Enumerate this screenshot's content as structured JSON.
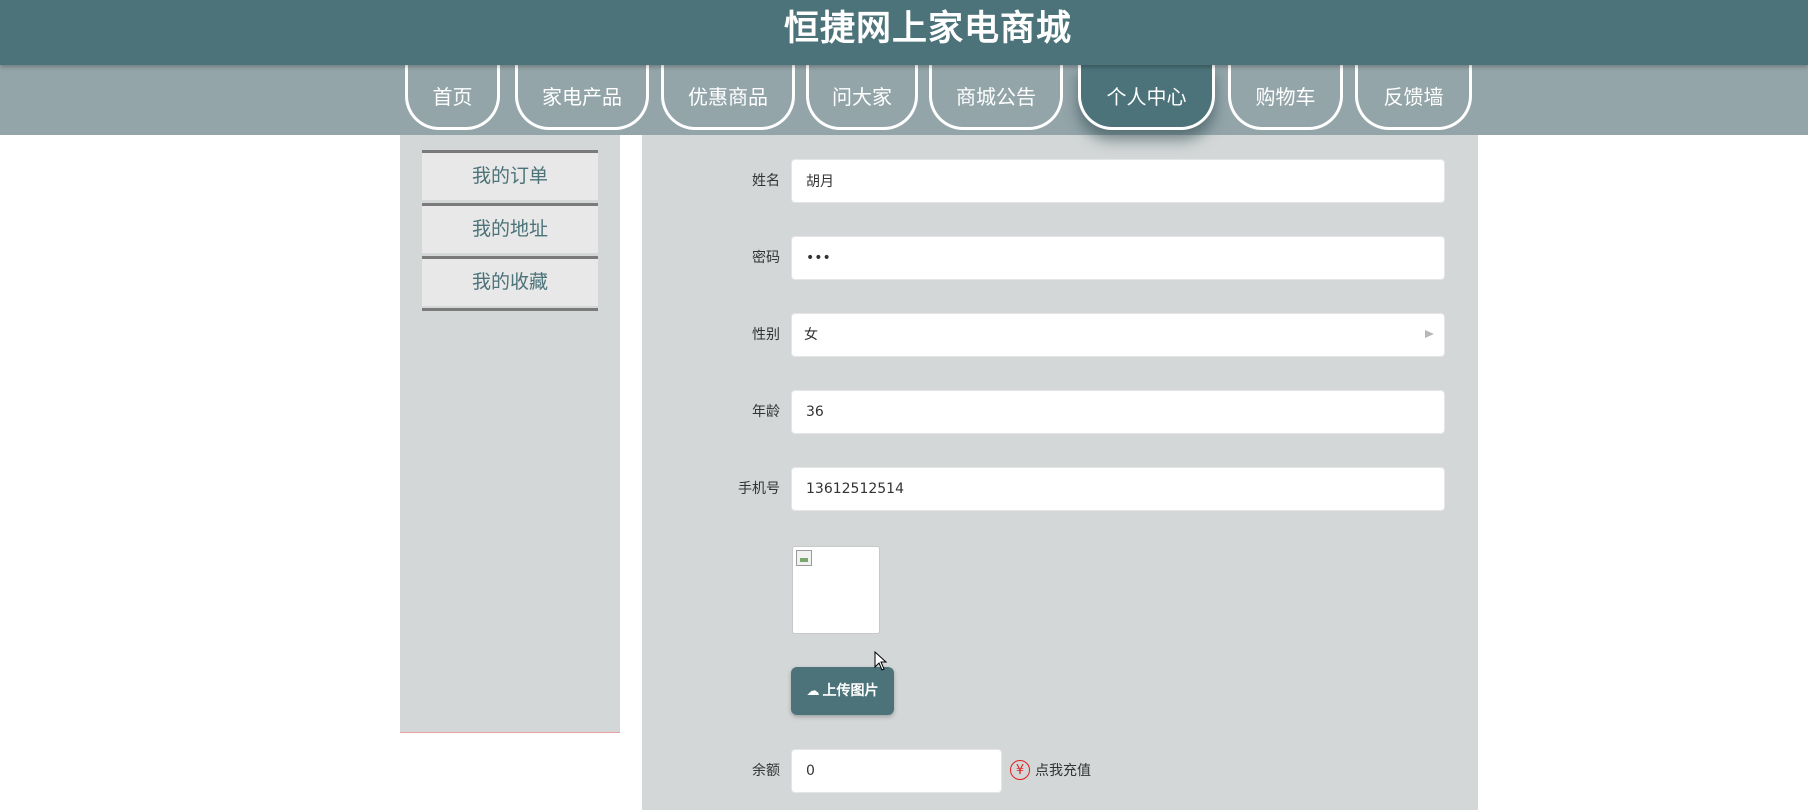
{
  "site": {
    "title": "恒捷网上家电商城"
  },
  "nav": {
    "items": [
      {
        "label": "首页"
      },
      {
        "label": "家电产品"
      },
      {
        "label": "优惠商品"
      },
      {
        "label": "问大家"
      },
      {
        "label": "商城公告"
      },
      {
        "label": "个人中心",
        "active": true
      },
      {
        "label": "购物车"
      },
      {
        "label": "反馈墙"
      }
    ]
  },
  "sidebar": {
    "items": [
      {
        "label": "我的订单"
      },
      {
        "label": "我的地址"
      },
      {
        "label": "我的收藏"
      }
    ]
  },
  "form": {
    "name": {
      "label": "姓名",
      "value": "胡月"
    },
    "password": {
      "label": "密码",
      "value": "•••"
    },
    "gender": {
      "label": "性别",
      "value": "女"
    },
    "age": {
      "label": "年龄",
      "value": "36"
    },
    "phone": {
      "label": "手机号",
      "value": "13612512514"
    },
    "upload": {
      "label": "上传图片"
    },
    "balance": {
      "label": "余额",
      "value": "0",
      "recharge_label": "点我充值"
    }
  },
  "colors": {
    "header": "#4b7379",
    "navbar": "#93a5a9",
    "panel": "#d3d7d7",
    "accent": "#e02020"
  }
}
